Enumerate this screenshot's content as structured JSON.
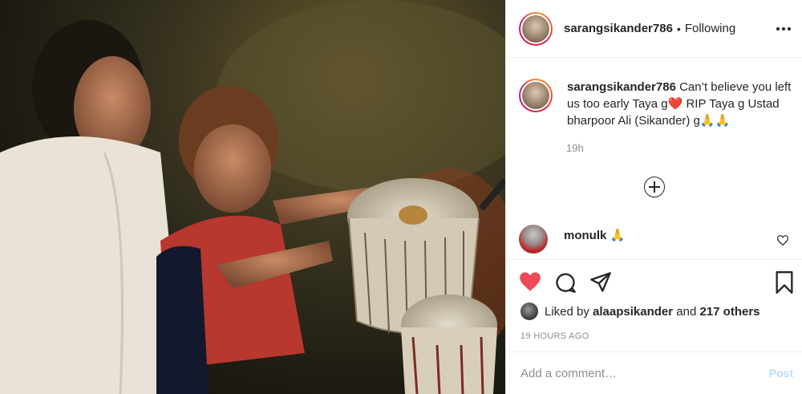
{
  "post": {
    "username": "sarangsikander786",
    "separator": "•",
    "follow_status": "Following",
    "caption_text": "Can’t believe you left us too early Taya g❤️ RIP Taya g Ustad bharpoor Ali (Sikander) g🙏🙏",
    "time_ago": "19h",
    "timestamp": "19 HOURS AGO"
  },
  "comments": [
    {
      "username": "monulk",
      "text": "🙏"
    }
  ],
  "likes": {
    "prefix": "Liked by",
    "user": "alaapsikander",
    "middle": "and",
    "others": "217 others"
  },
  "composer": {
    "placeholder": "Add a comment…",
    "post_label": "Post"
  },
  "colors": {
    "like_active": "#ed4956",
    "post_disabled": "#b2dffc",
    "secondary_text": "#8e8e8e"
  },
  "icons": [
    "more-options-icon",
    "plus-circle-icon",
    "heart-icon",
    "comment-icon",
    "share-icon",
    "bookmark-icon"
  ]
}
